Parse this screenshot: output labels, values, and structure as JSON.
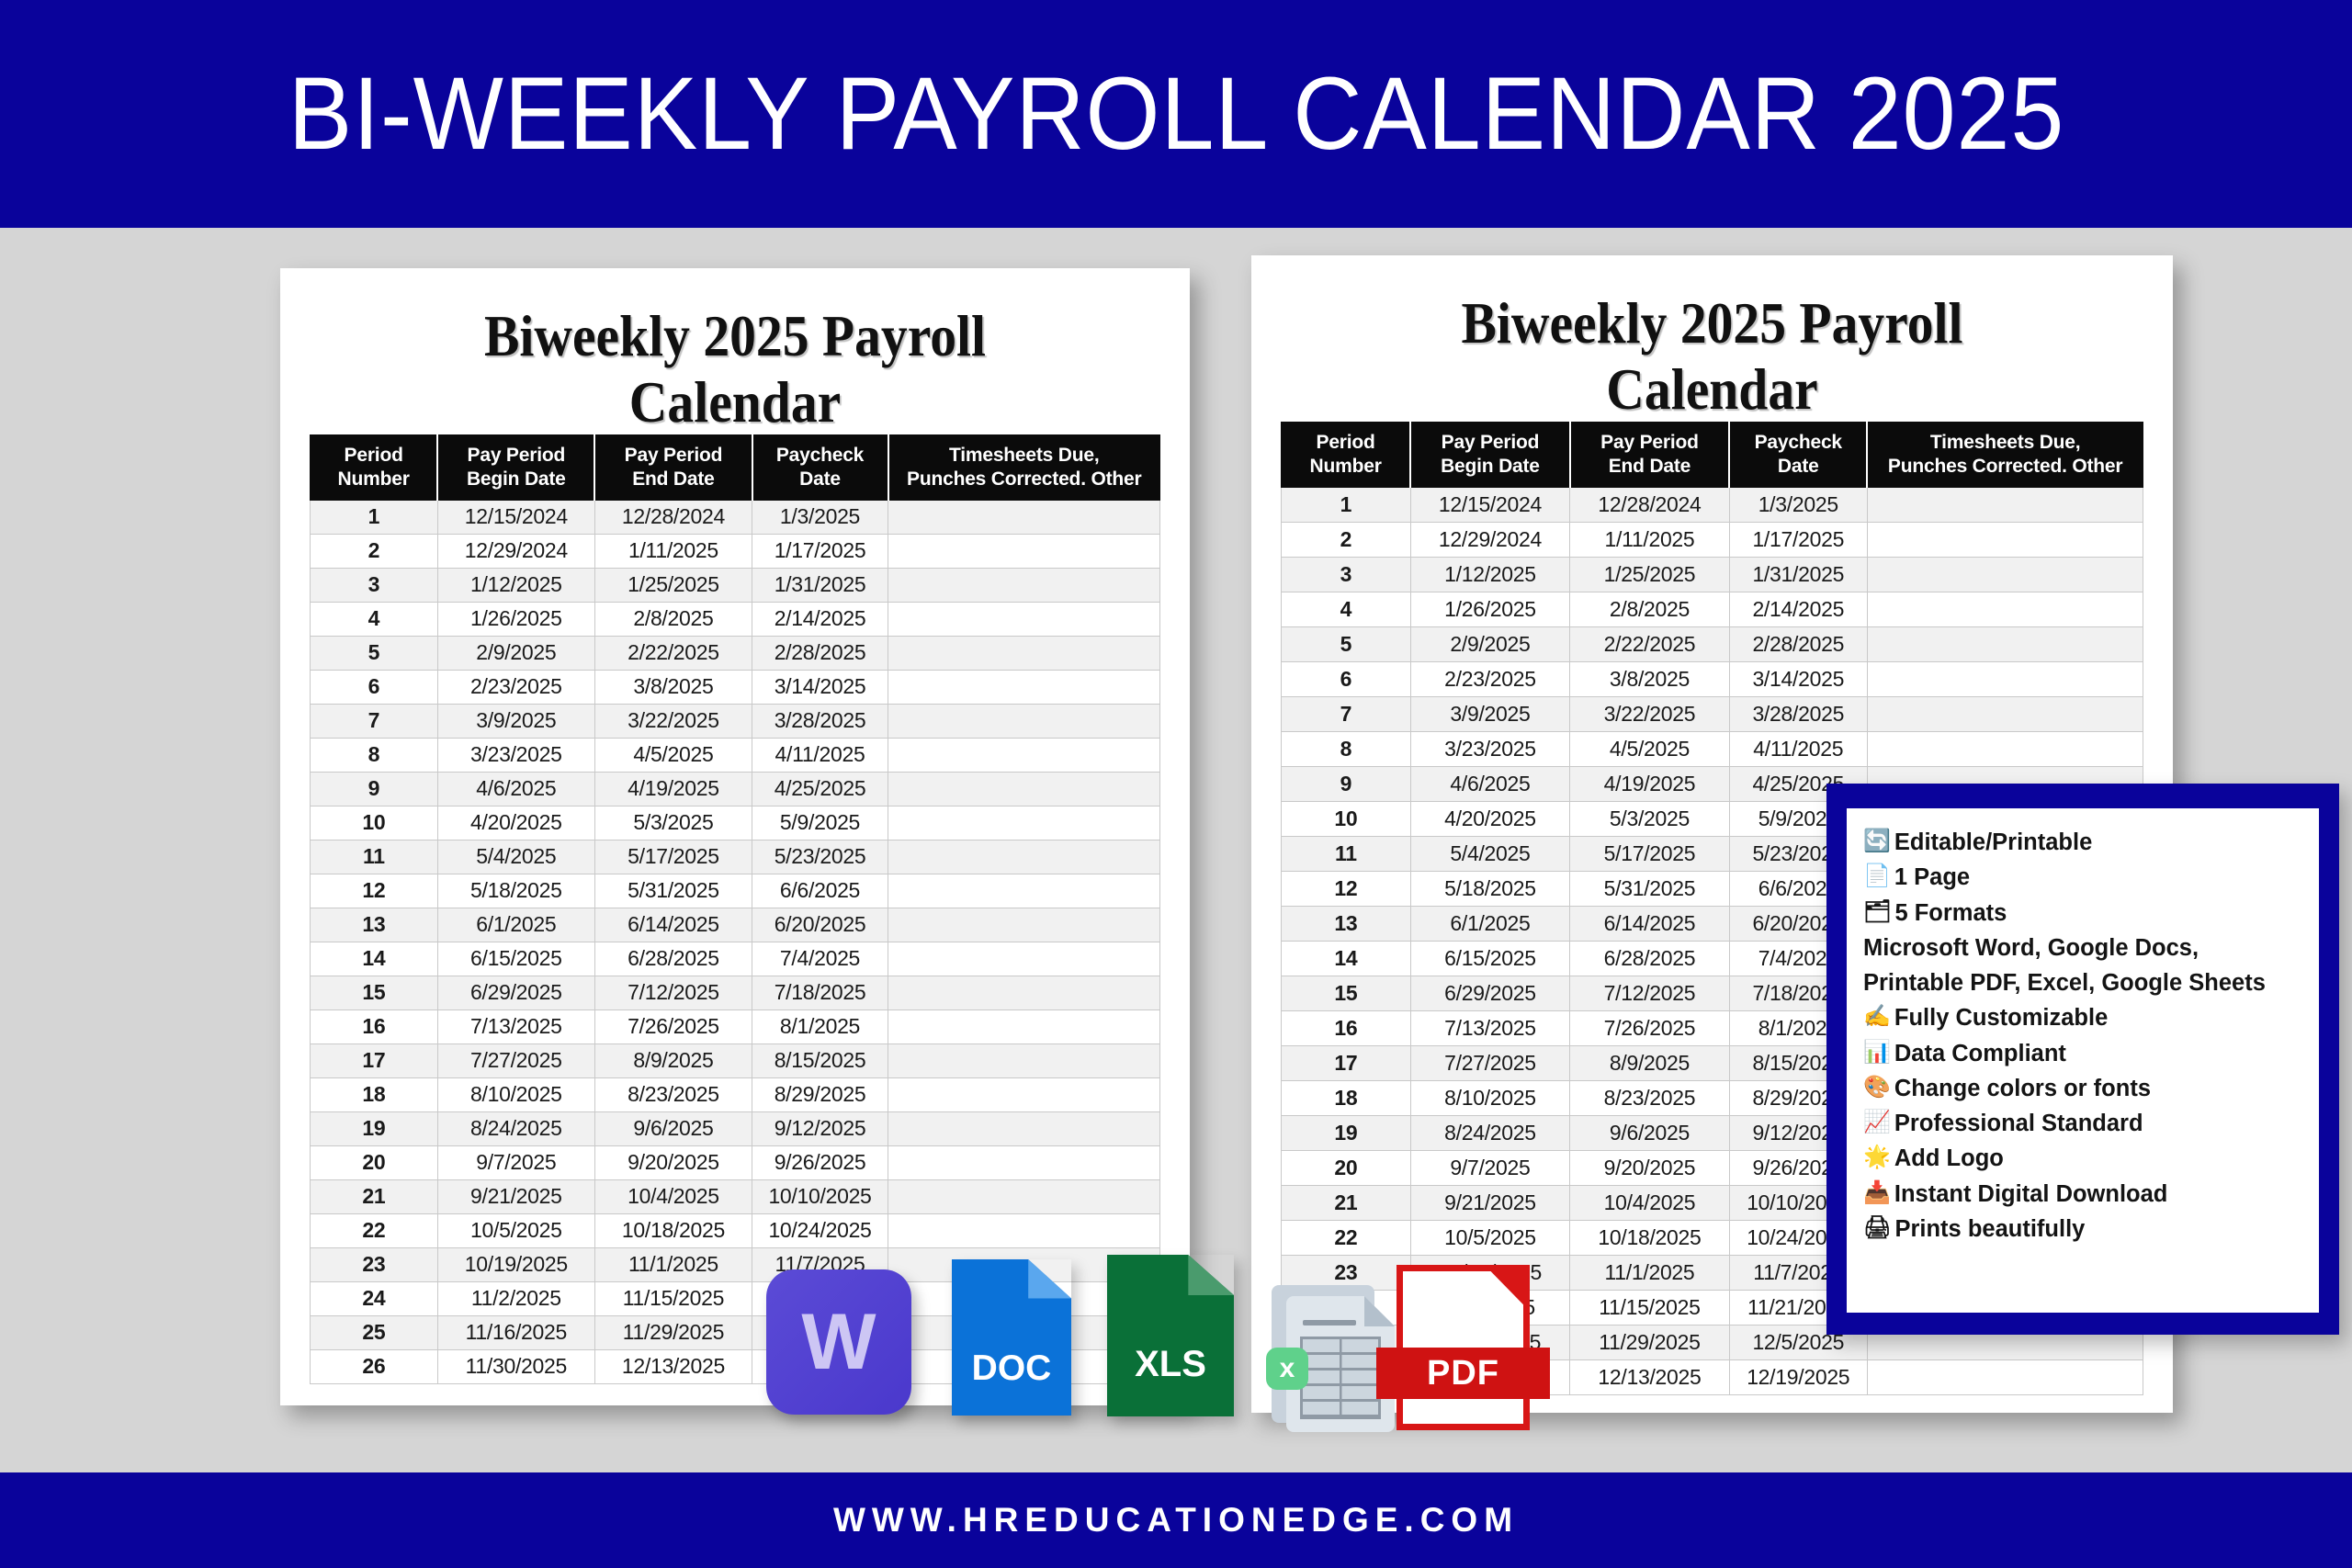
{
  "banner": {
    "title": "BI-WEEKLY PAYROLL CALENDAR 2025",
    "accent_color": "#0a039b",
    "text_color": "#ffffff"
  },
  "footer": {
    "url": "WWW.HREDUCATIONEDGE.COM"
  },
  "page": {
    "background_color": "#d5d5d5"
  },
  "document": {
    "title_line1": "Biweekly 2025 Payroll",
    "title_line2": "Calendar",
    "table": {
      "header_bg": "#0b0b0b",
      "header_text_color": "#ffffff",
      "columns": [
        {
          "line1": "Period",
          "line2": "Number"
        },
        {
          "line1": "Pay Period",
          "line2": "Begin Date"
        },
        {
          "line1": "Pay Period",
          "line2": "End Date"
        },
        {
          "line1": "Paycheck",
          "line2": "Date"
        },
        {
          "line1": "Timesheets Due,",
          "line2": "Punches Corrected. Other"
        }
      ],
      "rows": [
        {
          "period": "1",
          "begin": "12/15/2024",
          "end": "12/28/2024",
          "check": "1/3/2025",
          "notes": ""
        },
        {
          "period": "2",
          "begin": "12/29/2024",
          "end": "1/11/2025",
          "check": "1/17/2025",
          "notes": ""
        },
        {
          "period": "3",
          "begin": "1/12/2025",
          "end": "1/25/2025",
          "check": "1/31/2025",
          "notes": ""
        },
        {
          "period": "4",
          "begin": "1/26/2025",
          "end": "2/8/2025",
          "check": "2/14/2025",
          "notes": ""
        },
        {
          "period": "5",
          "begin": "2/9/2025",
          "end": "2/22/2025",
          "check": "2/28/2025",
          "notes": ""
        },
        {
          "period": "6",
          "begin": "2/23/2025",
          "end": "3/8/2025",
          "check": "3/14/2025",
          "notes": ""
        },
        {
          "period": "7",
          "begin": "3/9/2025",
          "end": "3/22/2025",
          "check": "3/28/2025",
          "notes": ""
        },
        {
          "period": "8",
          "begin": "3/23/2025",
          "end": "4/5/2025",
          "check": "4/11/2025",
          "notes": ""
        },
        {
          "period": "9",
          "begin": "4/6/2025",
          "end": "4/19/2025",
          "check": "4/25/2025",
          "notes": ""
        },
        {
          "period": "10",
          "begin": "4/20/2025",
          "end": "5/3/2025",
          "check": "5/9/2025",
          "notes": ""
        },
        {
          "period": "11",
          "begin": "5/4/2025",
          "end": "5/17/2025",
          "check": "5/23/2025",
          "notes": ""
        },
        {
          "period": "12",
          "begin": "5/18/2025",
          "end": "5/31/2025",
          "check": "6/6/2025",
          "notes": ""
        },
        {
          "period": "13",
          "begin": "6/1/2025",
          "end": "6/14/2025",
          "check": "6/20/2025",
          "notes": ""
        },
        {
          "period": "14",
          "begin": "6/15/2025",
          "end": "6/28/2025",
          "check": "7/4/2025",
          "notes": ""
        },
        {
          "period": "15",
          "begin": "6/29/2025",
          "end": "7/12/2025",
          "check": "7/18/2025",
          "notes": ""
        },
        {
          "period": "16",
          "begin": "7/13/2025",
          "end": "7/26/2025",
          "check": "8/1/2025",
          "notes": ""
        },
        {
          "period": "17",
          "begin": "7/27/2025",
          "end": "8/9/2025",
          "check": "8/15/2025",
          "notes": ""
        },
        {
          "period": "18",
          "begin": "8/10/2025",
          "end": "8/23/2025",
          "check": "8/29/2025",
          "notes": ""
        },
        {
          "period": "19",
          "begin": "8/24/2025",
          "end": "9/6/2025",
          "check": "9/12/2025",
          "notes": ""
        },
        {
          "period": "20",
          "begin": "9/7/2025",
          "end": "9/20/2025",
          "check": "9/26/2025",
          "notes": ""
        },
        {
          "period": "21",
          "begin": "9/21/2025",
          "end": "10/4/2025",
          "check": "10/10/2025",
          "notes": ""
        },
        {
          "period": "22",
          "begin": "10/5/2025",
          "end": "10/18/2025",
          "check": "10/24/2025",
          "notes": ""
        },
        {
          "period": "23",
          "begin": "10/19/2025",
          "end": "11/1/2025",
          "check": "11/7/2025",
          "notes": ""
        },
        {
          "period": "24",
          "begin": "11/2/2025",
          "end": "11/15/2025",
          "check": "11/21/2025",
          "notes": ""
        },
        {
          "period": "25",
          "begin": "11/16/2025",
          "end": "11/29/2025",
          "check": "12/5/2025",
          "notes": ""
        },
        {
          "period": "26",
          "begin": "11/30/2025",
          "end": "12/13/2025",
          "check": "12/19/2025",
          "notes": ""
        }
      ]
    }
  },
  "info_box": {
    "border_color": "#0a039b",
    "lines": [
      {
        "icon": "🔄",
        "icon_name": "refresh-icon",
        "text": "Editable/Printable"
      },
      {
        "icon": "📄",
        "icon_name": "page-icon",
        "text": "1 Page"
      },
      {
        "icon": "🗂",
        "icon_name": "formats-icon",
        "text": "5 Formats"
      },
      {
        "icon": "",
        "icon_name": "formats-list",
        "text": "Microsoft Word, Google Docs, Printable PDF, Excel, Google Sheets"
      },
      {
        "icon": "✍️",
        "icon_name": "writing-hand-icon",
        "text": "Fully Customizable"
      },
      {
        "icon": "📊",
        "icon_name": "bar-chart-icon",
        "text": "Data Compliant"
      },
      {
        "icon": "🎨",
        "icon_name": "palette-icon",
        "text": "Change colors or fonts"
      },
      {
        "icon": "📈",
        "icon_name": "chart-increasing-icon",
        "text": "Professional Standard"
      },
      {
        "icon": "🌟",
        "icon_name": "star-icon",
        "text": "Add Logo"
      },
      {
        "icon": "📥",
        "icon_name": "inbox-download-icon",
        "text": "Instant Digital Download"
      },
      {
        "icon": "🖨",
        "icon_name": "printer-icon",
        "text": "Prints beautifully"
      }
    ]
  },
  "file_icons": {
    "word": {
      "label": "W",
      "color": "#4a38cc"
    },
    "doc": {
      "label": "DOC",
      "color": "#0b72d8"
    },
    "xls": {
      "label": "XLS",
      "color": "#0a7038"
    },
    "excel": {
      "label": "x",
      "color": "#5fd18b"
    },
    "pdf": {
      "label": "PDF",
      "color": "#d81616"
    }
  }
}
